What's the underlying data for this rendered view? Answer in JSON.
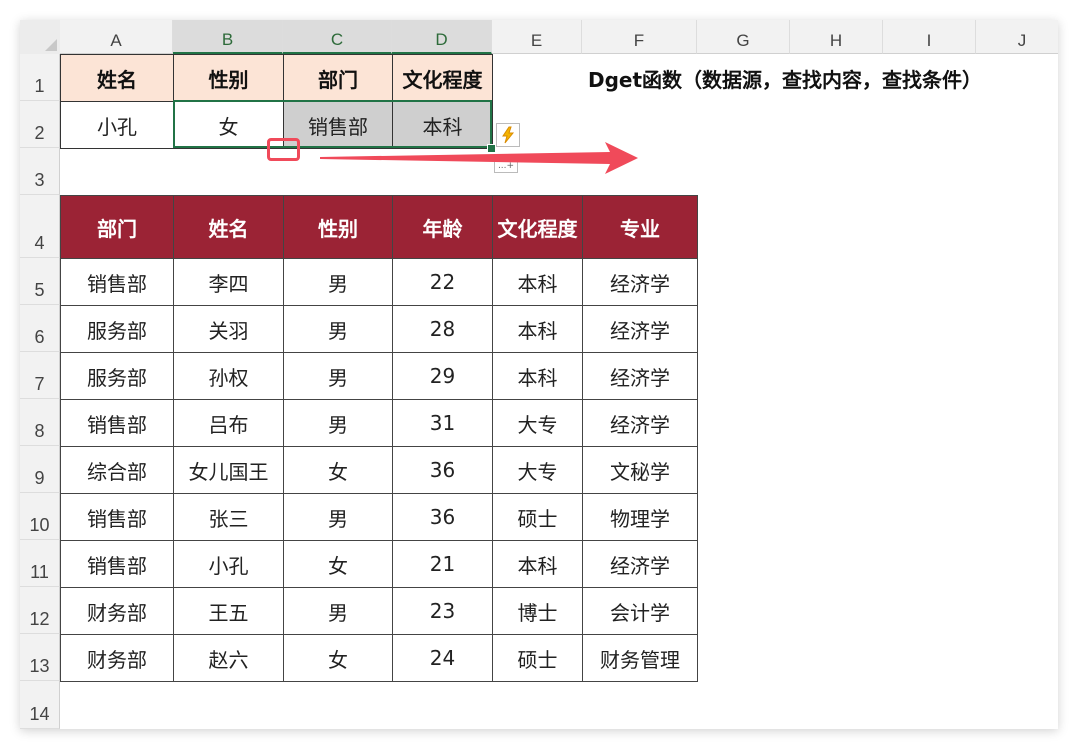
{
  "columns": [
    "A",
    "B",
    "C",
    "D",
    "E",
    "F",
    "G",
    "H",
    "I",
    "J"
  ],
  "rows": [
    "1",
    "2",
    "3",
    "4",
    "5",
    "6",
    "7",
    "8",
    "9",
    "10",
    "11",
    "12",
    "13",
    "14"
  ],
  "criteria": {
    "headers": [
      "姓名",
      "性别",
      "部门",
      "文化程度"
    ],
    "values": [
      "小孔",
      "女",
      "销售部",
      "本科"
    ]
  },
  "title": "Dget函数（数据源，查找内容，查找条件）",
  "table": {
    "headers": [
      "部门",
      "姓名",
      "性别",
      "年龄",
      "文化程度",
      "专业"
    ],
    "rows": [
      [
        "销售部",
        "李四",
        "男",
        "22",
        "本科",
        "经济学"
      ],
      [
        "服务部",
        "关羽",
        "男",
        "28",
        "本科",
        "经济学"
      ],
      [
        "服务部",
        "孙权",
        "男",
        "29",
        "本科",
        "经济学"
      ],
      [
        "销售部",
        "吕布",
        "男",
        "31",
        "大专",
        "经济学"
      ],
      [
        "综合部",
        "女儿国王",
        "女",
        "36",
        "大专",
        "文秘学"
      ],
      [
        "销售部",
        "张三",
        "男",
        "36",
        "硕士",
        "物理学"
      ],
      [
        "销售部",
        "小孔",
        "女",
        "21",
        "本科",
        "经济学"
      ],
      [
        "财务部",
        "王五",
        "男",
        "23",
        "博士",
        "会计学"
      ],
      [
        "财务部",
        "赵六",
        "女",
        "24",
        "硕士",
        "财务管理"
      ]
    ]
  },
  "icons": {
    "flash_fill": "lightning-icon",
    "paste_options": "paste-options-icon",
    "paste_options_text": "...+",
    "annotation_arrow": "red-arrow-icon"
  },
  "colors": {
    "header_fill": "#9b2335",
    "criteria_header_fill": "#fce4d6",
    "selection_border": "#217346",
    "annotation": "#f04a5a"
  }
}
